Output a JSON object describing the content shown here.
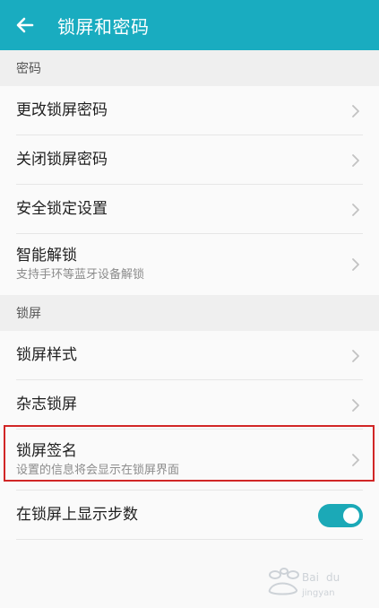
{
  "header": {
    "title": "锁屏和密码"
  },
  "sections": [
    {
      "header": "密码",
      "rows": [
        {
          "label": "更改锁屏密码"
        },
        {
          "label": "关闭锁屏密码"
        },
        {
          "label": "安全锁定设置"
        },
        {
          "label": "智能解锁",
          "sublabel": "支持手环等蓝牙设备解锁"
        }
      ]
    },
    {
      "header": "锁屏",
      "rows": [
        {
          "label": "锁屏样式"
        },
        {
          "label": "杂志锁屏"
        },
        {
          "label": "锁屏签名",
          "sublabel": "设置的信息将会显示在锁屏界面"
        },
        {
          "label": "在锁屏上显示步数",
          "toggle_on": true
        }
      ]
    }
  ],
  "colors": {
    "topbar": "#19acc0",
    "toggle_on": "#1ba9b7",
    "highlight": "#d12626"
  },
  "icons": {
    "back": "back-arrow-icon",
    "chevron": "chevron-right-icon"
  }
}
